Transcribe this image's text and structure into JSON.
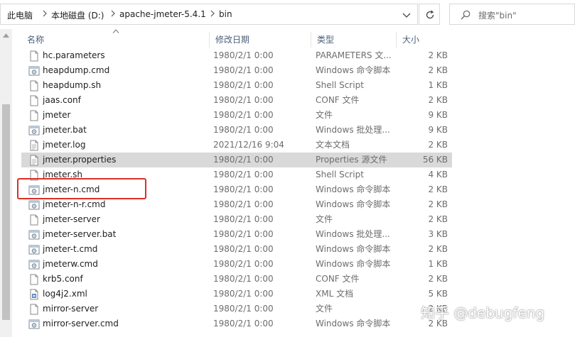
{
  "breadcrumb": [
    "此电脑",
    "本地磁盘 (D:)",
    "apache-jmeter-5.4.1",
    "bin"
  ],
  "search": {
    "placeholder": "搜索\"bin\""
  },
  "columns": {
    "name": "名称",
    "date": "修改日期",
    "type": "类型",
    "size": "大小"
  },
  "files": [
    {
      "name": "hc.parameters",
      "date": "1980/2/1 0:00",
      "type": "PARAMETERS 文...",
      "size": "2 KB",
      "icon": "file-icon"
    },
    {
      "name": "heapdump.cmd",
      "date": "1980/2/1 0:00",
      "type": "Windows 命令脚本",
      "size": "2 KB",
      "icon": "script-icon"
    },
    {
      "name": "heapdump.sh",
      "date": "1980/2/1 0:00",
      "type": "Shell Script",
      "size": "1 KB",
      "icon": "file-icon"
    },
    {
      "name": "jaas.conf",
      "date": "1980/2/1 0:00",
      "type": "CONF 文件",
      "size": "2 KB",
      "icon": "file-icon"
    },
    {
      "name": "jmeter",
      "date": "1980/2/1 0:00",
      "type": "文件",
      "size": "9 KB",
      "icon": "file-icon"
    },
    {
      "name": "jmeter.bat",
      "date": "1980/2/1 0:00",
      "type": "Windows 批处理...",
      "size": "9 KB",
      "icon": "script-icon"
    },
    {
      "name": "jmeter.log",
      "date": "2021/12/16 9:04",
      "type": "文本文档",
      "size": "2 KB",
      "icon": "text-file-icon"
    },
    {
      "name": "jmeter.properties",
      "date": "1980/2/1 0:00",
      "type": "Properties 源文件",
      "size": "56 KB",
      "icon": "text-file-icon"
    },
    {
      "name": "jmeter.sh",
      "date": "1980/2/1 0:00",
      "type": "Shell Script",
      "size": "4 KB",
      "icon": "file-icon"
    },
    {
      "name": "jmeter-n.cmd",
      "date": "1980/2/1 0:00",
      "type": "Windows 命令脚本",
      "size": "2 KB",
      "icon": "script-icon"
    },
    {
      "name": "jmeter-n-r.cmd",
      "date": "1980/2/1 0:00",
      "type": "Windows 命令脚本",
      "size": "2 KB",
      "icon": "script-icon"
    },
    {
      "name": "jmeter-server",
      "date": "1980/2/1 0:00",
      "type": "文件",
      "size": "2 KB",
      "icon": "file-icon"
    },
    {
      "name": "jmeter-server.bat",
      "date": "1980/2/1 0:00",
      "type": "Windows 批处理...",
      "size": "3 KB",
      "icon": "script-icon"
    },
    {
      "name": "jmeter-t.cmd",
      "date": "1980/2/1 0:00",
      "type": "Windows 命令脚本",
      "size": "2 KB",
      "icon": "script-icon"
    },
    {
      "name": "jmeterw.cmd",
      "date": "1980/2/1 0:00",
      "type": "Windows 命令脚本",
      "size": "1 KB",
      "icon": "script-icon"
    },
    {
      "name": "krb5.conf",
      "date": "1980/2/1 0:00",
      "type": "CONF 文件",
      "size": "2 KB",
      "icon": "file-icon"
    },
    {
      "name": "log4j2.xml",
      "date": "1980/2/1 0:00",
      "type": "XML 文档",
      "size": "5 KB",
      "icon": "xml-file-icon"
    },
    {
      "name": "mirror-server",
      "date": "1980/2/1 0:00",
      "type": "文件",
      "size": "2 KB",
      "icon": "file-icon"
    },
    {
      "name": "mirror-server.cmd",
      "date": "1980/2/1 0:00",
      "type": "Windows 命令脚本",
      "size": "2 KB",
      "icon": "script-icon"
    }
  ],
  "selected_file": "jmeter.properties",
  "watermark": "知乎 @debugfeng",
  "colors": {
    "selection": "#d9d9d9",
    "highlight_box": "#d93025",
    "header_text": "#4c607a"
  }
}
